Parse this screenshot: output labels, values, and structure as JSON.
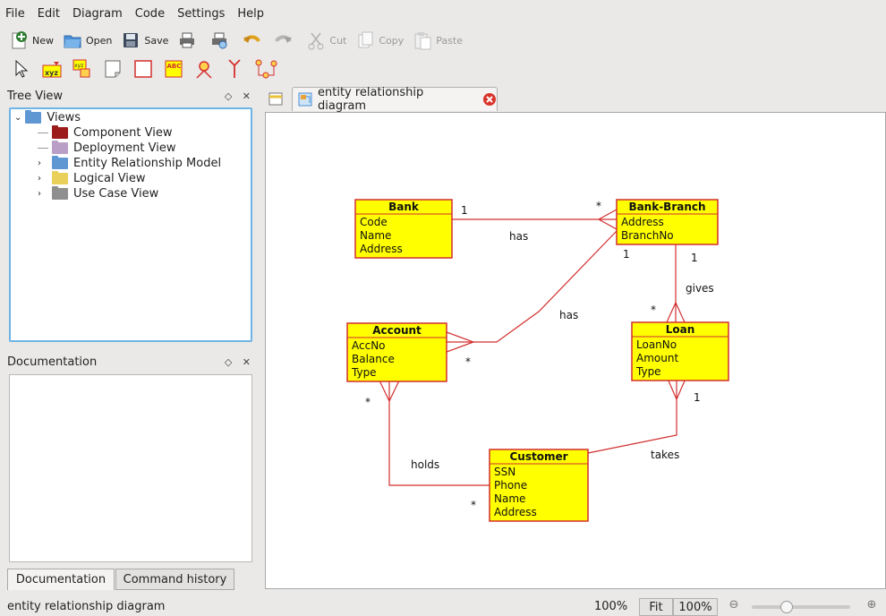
{
  "menubar": {
    "items": [
      {
        "label": "File"
      },
      {
        "label": "Edit"
      },
      {
        "label": "Diagram"
      },
      {
        "label": "Code"
      },
      {
        "label": "Settings"
      },
      {
        "label": "Help"
      }
    ]
  },
  "toolbar": {
    "new_label": "New",
    "open_label": "Open",
    "save_label": "Save",
    "cut_label": "Cut",
    "copy_label": "Copy",
    "paste_label": "Paste"
  },
  "tree_view": {
    "title": "Tree View",
    "root": "Views",
    "items": [
      {
        "label": "Component View",
        "color": "#9c1b1b"
      },
      {
        "label": "Deployment View",
        "color": "#b99fc6"
      },
      {
        "label": "Entity Relationship Model",
        "color": "#5f97d3"
      },
      {
        "label": "Logical View",
        "color": "#e9d05a"
      },
      {
        "label": "Use Case View",
        "color": "#8f8f8f"
      }
    ]
  },
  "documentation": {
    "title": "Documentation",
    "tabs": [
      "Documentation",
      "Command history"
    ]
  },
  "editor": {
    "tab_label": "entity relationship diagram"
  },
  "diagram": {
    "entity_fill": "#ffff00",
    "entity_border": "#d32f2f",
    "line_color": "#d32f2f",
    "entities": {
      "bank": {
        "name": "Bank",
        "attributes": [
          "Code",
          "Name",
          "Address"
        ]
      },
      "branch": {
        "name": "Bank-Branch",
        "attributes": [
          "Address",
          "BranchNo"
        ]
      },
      "account": {
        "name": "Account",
        "attributes": [
          "AccNo",
          "Balance",
          "Type"
        ]
      },
      "loan": {
        "name": "Loan",
        "attributes": [
          "LoanNo",
          "Amount",
          "Type"
        ]
      },
      "customer": {
        "name": "Customer",
        "attributes": [
          "SSN",
          "Phone",
          "Name",
          "Address"
        ]
      }
    },
    "relationships": {
      "bank_branch": {
        "label": "has",
        "from_mult": "1",
        "to_mult": "*"
      },
      "branch_account": {
        "label": "has",
        "from_mult": "1",
        "to_mult": "*"
      },
      "branch_loan": {
        "label": "gives",
        "from_mult": "1",
        "to_mult": "*"
      },
      "account_customer": {
        "label": "holds",
        "from_mult": "*",
        "to_mult": "*"
      },
      "loan_customer": {
        "label": "takes",
        "from_mult": "1"
      }
    }
  },
  "statusbar": {
    "message": "entity relationship diagram",
    "zoom": "100%",
    "fit_label": "Fit",
    "zoom_button": "100%"
  }
}
